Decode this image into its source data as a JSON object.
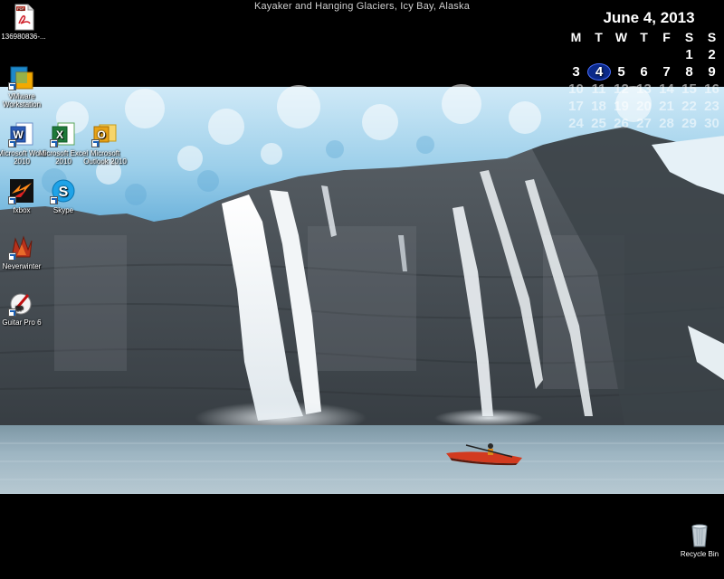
{
  "wallpaper": {
    "caption": "Kayaker and Hanging Glaciers, Icy Bay, Alaska"
  },
  "icons": {
    "pdf": {
      "label": "136980836-..."
    },
    "vmware": {
      "label": "VMware Workstation"
    },
    "word": {
      "label": "Microsoft Word 2010"
    },
    "excel": {
      "label": "Microsoft Excel 2010"
    },
    "outlook": {
      "label": "Microsoft Outlook 2010"
    },
    "fxbox": {
      "label": "fxbox"
    },
    "skype": {
      "label": "Skype"
    },
    "neverwinter": {
      "label": "Neverwinter"
    },
    "guitarpro": {
      "label": "Guitar Pro 6"
    },
    "recycle": {
      "label": "Recycle Bin"
    }
  },
  "calendar": {
    "title": "June 4, 2013",
    "weekdays": [
      "M",
      "T",
      "W",
      "T",
      "F",
      "S",
      "S"
    ],
    "weeks": [
      [
        "",
        "",
        "",
        "",
        "",
        "1",
        "2"
      ],
      [
        "3",
        "4",
        "5",
        "6",
        "7",
        "8",
        "9"
      ],
      [
        "10",
        "11",
        "12",
        "13",
        "14",
        "15",
        "16"
      ],
      [
        "17",
        "18",
        "19",
        "20",
        "21",
        "22",
        "23"
      ],
      [
        "24",
        "25",
        "26",
        "27",
        "28",
        "29",
        "30"
      ]
    ],
    "today": "4"
  },
  "colors": {
    "glacier": "#a9d6ee",
    "rock": "#4a5158",
    "water": "#8aa7b6",
    "kayak": "#d23a1f",
    "calendar_today": "#0b2a8a"
  }
}
